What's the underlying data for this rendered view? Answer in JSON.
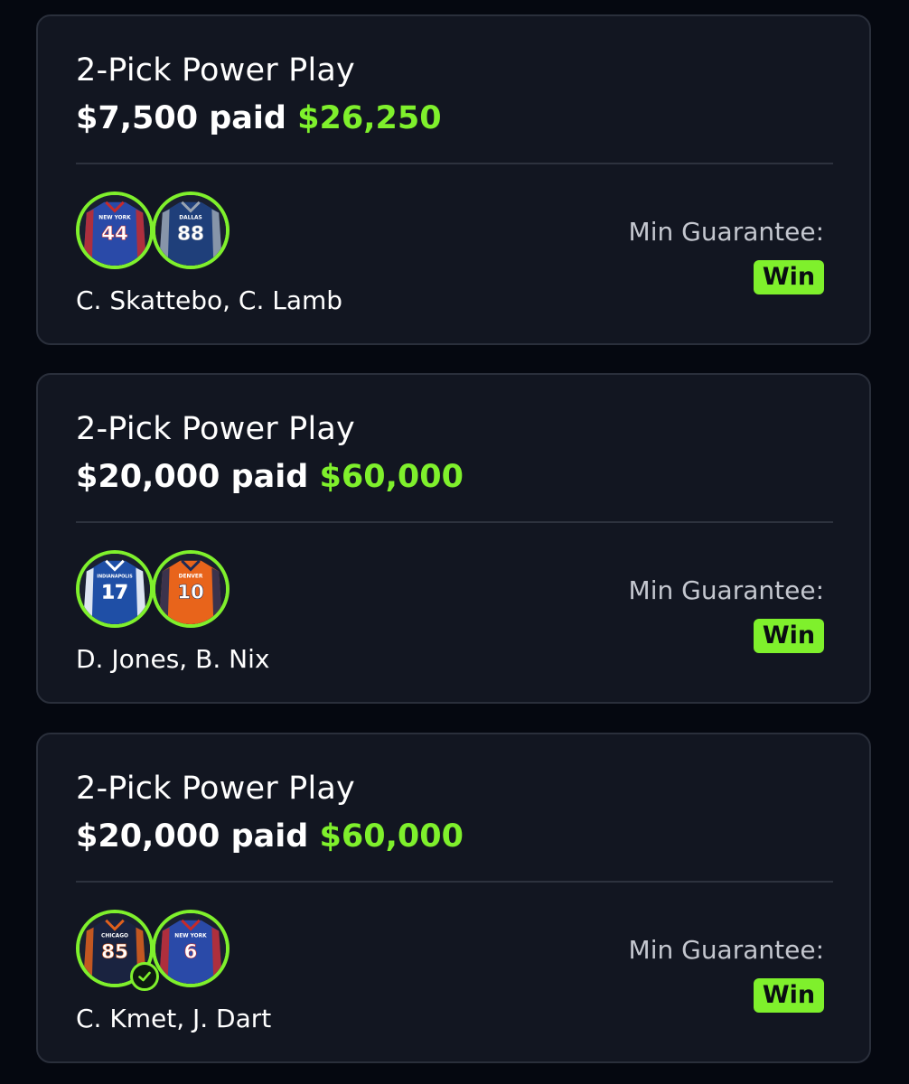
{
  "colors": {
    "background": "#050810",
    "card": "#121621",
    "accent_green": "#7ff02c"
  },
  "cards": [
    {
      "title": "2-Pick Power Play",
      "paid": "$7,500 paid",
      "payout": "$26,250",
      "players": "C. Skattebo, C. Lamb",
      "guarantee_label": "Min Guarantee:",
      "result": "Win",
      "jerseys": [
        {
          "team": "NEW YORK",
          "number": "44",
          "color": "#2a4aa8",
          "trim": "#c62a2a"
        },
        {
          "team": "DALLAS",
          "number": "88",
          "color": "#1f3f7a",
          "trim": "#9aa4b2"
        }
      ]
    },
    {
      "title": "2-Pick Power Play",
      "paid": "$20,000 paid",
      "payout": "$60,000",
      "players": "D. Jones, B. Nix",
      "guarantee_label": "Min Guarantee:",
      "result": "Win",
      "jerseys": [
        {
          "team": "INDIANAPOLIS",
          "number": "17",
          "color": "#1f4fa6",
          "trim": "#ffffff"
        },
        {
          "team": "DENVER",
          "number": "10",
          "color": "#e8641b",
          "trim": "#1c2a55"
        }
      ]
    },
    {
      "title": "2-Pick Power Play",
      "paid": "$20,000 paid",
      "payout": "$60,000",
      "players": "C. Kmet, J. Dart",
      "guarantee_label": "Min Guarantee:",
      "result": "Win",
      "jerseys": [
        {
          "team": "CHICAGO",
          "number": "85",
          "color": "#1a2340",
          "trim": "#e0601c"
        },
        {
          "team": "NEW YORK",
          "number": "6",
          "color": "#2a4aa8",
          "trim": "#c62a2a"
        }
      ]
    }
  ]
}
